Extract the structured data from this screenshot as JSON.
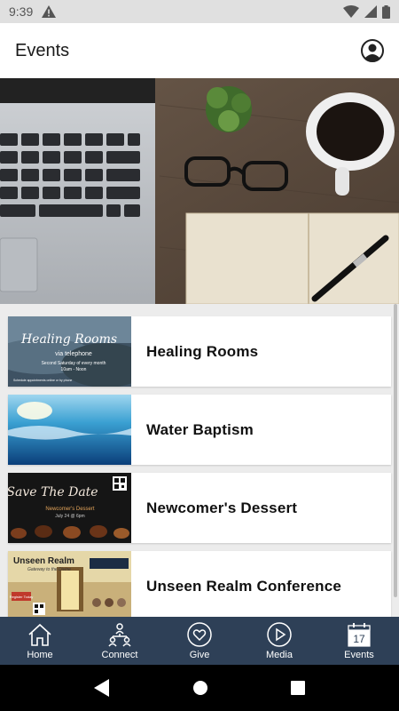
{
  "status_bar": {
    "time": "9:39"
  },
  "header": {
    "title": "Events"
  },
  "events": [
    {
      "title": "Healing Rooms",
      "thumb": {
        "title": "Healing Rooms",
        "subtitle": "via telephone",
        "line1": "Second Saturday of every month",
        "line2": "10am - Noon",
        "note": "Schedule appointments online or by phone"
      }
    },
    {
      "title": "Water Baptism"
    },
    {
      "title": "Newcomer's Dessert",
      "thumb": {
        "title": "Save The Date",
        "subtitle": "Newcomer's Dessert",
        "line1": "July 24 @ 6pm"
      }
    },
    {
      "title": "Unseen Realm Conference",
      "thumb": {
        "title": "Unseen Realm",
        "subtitle": "Gateway to the Divine",
        "note": "Register Today"
      }
    }
  ],
  "bottom_nav": [
    {
      "label": "Home",
      "icon": "home-icon"
    },
    {
      "label": "Connect",
      "icon": "connect-icon"
    },
    {
      "label": "Give",
      "icon": "give-heart-icon"
    },
    {
      "label": "Media",
      "icon": "media-play-icon"
    },
    {
      "label": "Events",
      "icon": "calendar-icon",
      "calendar_day": "17"
    }
  ],
  "colors": {
    "nav_background": "#2e4057",
    "app_bar": "#ffffff",
    "list_background": "#ececec"
  }
}
